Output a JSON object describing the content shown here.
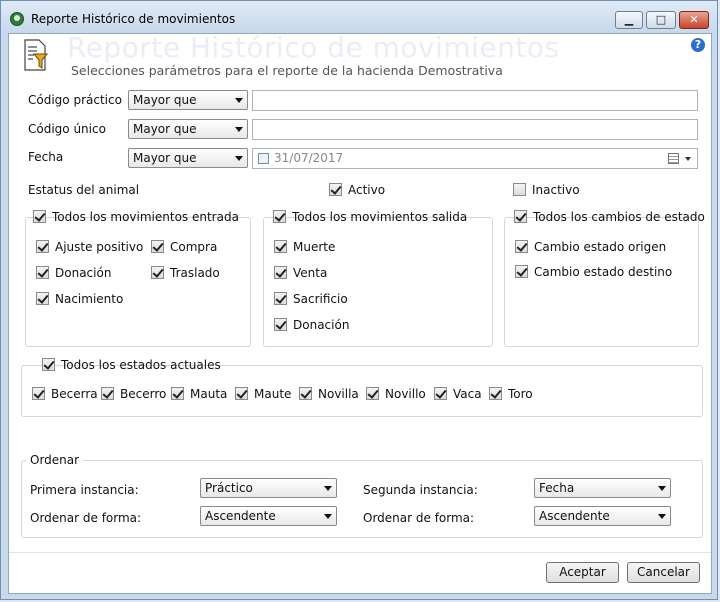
{
  "window": {
    "title": "Reporte Histórico de movimientos",
    "min_glyph": "▁",
    "max_glyph": "□",
    "close_glyph": "✕"
  },
  "header": {
    "title": "Reporte Histórico de movimientos",
    "subtitle": "Selecciones parámetros para el reporte de la hacienda Demostrativa",
    "help": "?"
  },
  "filters": {
    "codigo_practico": {
      "label": "Código práctico",
      "operator": "Mayor que",
      "value": ""
    },
    "codigo_unico": {
      "label": "Código único",
      "operator": "Mayor que",
      "value": ""
    },
    "fecha": {
      "label": "Fecha",
      "operator": "Mayor que",
      "value": "31/07/2017"
    }
  },
  "estatus": {
    "label": "Estatus del animal",
    "activo": "Activo",
    "inactivo": "Inactivo"
  },
  "entrada": {
    "header": "Todos los movimientos entrada",
    "items": [
      "Ajuste positivo",
      "Donación",
      "Nacimiento",
      "Compra",
      "Traslado"
    ]
  },
  "salida": {
    "header": "Todos los movimientos salida",
    "items": [
      "Muerte",
      "Venta",
      "Sacrificio",
      "Donación"
    ]
  },
  "cambios": {
    "header": "Todos los cambios de estado",
    "items": [
      "Cambio estado origen",
      "Cambio estado destino"
    ]
  },
  "estados": {
    "header": "Todos los estados actuales",
    "items": [
      "Becerra",
      "Becerro",
      "Mauta",
      "Maute",
      "Novilla",
      "Novillo",
      "Vaca",
      "Toro"
    ]
  },
  "ordenar": {
    "title": "Ordenar",
    "primera_label": "Primera instancia:",
    "primera_value": "Práctico",
    "forma1_label": "Ordenar de forma:",
    "forma1_value": "Ascendente",
    "segunda_label": "Segunda instancia:",
    "segunda_value": "Fecha",
    "forma2_label": "Ordenar de forma:",
    "forma2_value": "Ascendente"
  },
  "buttons": {
    "accept": "Aceptar",
    "cancel": "Cancelar"
  }
}
